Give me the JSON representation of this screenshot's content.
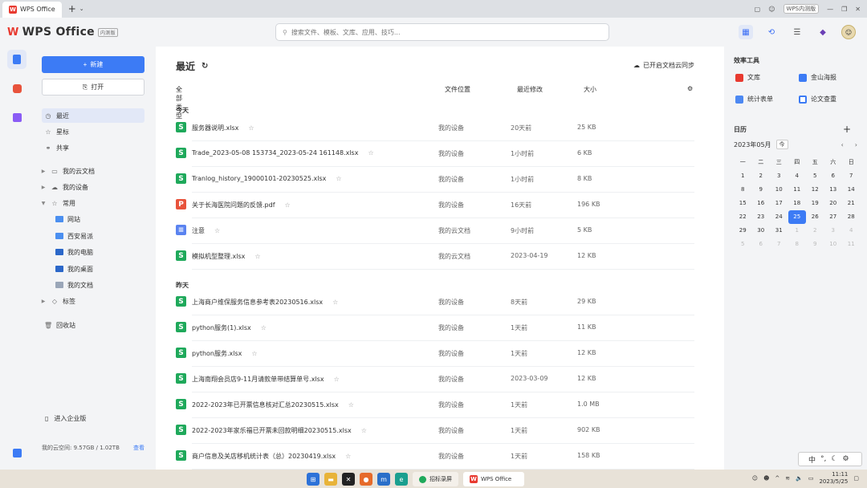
{
  "tab": {
    "label": "WPS Office"
  },
  "titlebar": {
    "badge": "WPS内测版"
  },
  "brand": {
    "name": "WPS Office",
    "tag": "内测版"
  },
  "search": {
    "placeholder": "搜索文件、模板、文库、应用、技巧..."
  },
  "sidebar": {
    "new_label": "新建",
    "open_label": "打开",
    "recent": "最近",
    "starred": "星标",
    "shared": "共享",
    "cloud": "我的云文档",
    "device": "我的设备",
    "common": "常用",
    "f1": "网站",
    "f2": "西安易派",
    "f3": "我的电脑",
    "f4": "我的桌面",
    "f5": "我的文档",
    "tags": "标签",
    "trash": "回收站",
    "enterprise": "进入企业版",
    "storage": "我的云空间: 9.57GB / 1.02TB",
    "storage_link": "查看"
  },
  "main": {
    "title": "最近",
    "sync": "已开启文档云同步",
    "col_type": "全部类型",
    "col_loc": "文件位置",
    "col_mod": "最近修改",
    "col_size": "大小",
    "today": "今天",
    "yesterday": "昨天",
    "files": [
      {
        "name": "服务器说明.xlsx",
        "loc": "我的设备",
        "mod": "20天前",
        "size": "25 KB",
        "kind": "s"
      },
      {
        "name": "Trade_2023-05-08 153734_2023-05-24 161148.xlsx",
        "loc": "我的设备",
        "mod": "1小时前",
        "size": "6 KB",
        "kind": "s"
      },
      {
        "name": "Tranlog_history_19000101-20230525.xlsx",
        "loc": "我的设备",
        "mod": "1小时前",
        "size": "8 KB",
        "kind": "s"
      },
      {
        "name": "关于长海医院问题的反馈.pdf",
        "loc": "我的设备",
        "mod": "16天前",
        "size": "196 KB",
        "kind": "p"
      },
      {
        "name": "注意",
        "loc": "我的云文档",
        "mod": "9小时前",
        "size": "5 KB",
        "kind": "n"
      },
      {
        "name": "模拟机型整理.xlsx",
        "loc": "我的云文档",
        "mod": "2023-04-19",
        "size": "12 KB",
        "kind": "s"
      },
      {
        "name": "上海商户维保服务信息参考表20230516.xlsx",
        "loc": "我的设备",
        "mod": "8天前",
        "size": "29 KB",
        "kind": "s"
      },
      {
        "name": "python服务(1).xlsx",
        "loc": "我的设备",
        "mod": "1天前",
        "size": "11 KB",
        "kind": "s"
      },
      {
        "name": "python服务.xlsx",
        "loc": "我的设备",
        "mod": "1天前",
        "size": "12 KB",
        "kind": "s"
      },
      {
        "name": "上海南翔会员店9-11月请款单带结算单号.xlsx",
        "loc": "我的设备",
        "mod": "2023-03-09",
        "size": "12 KB",
        "kind": "s"
      },
      {
        "name": "2022-2023年已开票信息核对汇总20230515.xlsx",
        "loc": "我的设备",
        "mod": "1天前",
        "size": "1.0 MB",
        "kind": "s"
      },
      {
        "name": "2022-2023年家乐福已开票未回款明细20230515.xlsx",
        "loc": "我的设备",
        "mod": "1天前",
        "size": "902 KB",
        "kind": "s"
      },
      {
        "name": "商户信息及关店移机统计表（总）20230419.xlsx",
        "loc": "我的设备",
        "mod": "1天前",
        "size": "158 KB",
        "kind": "s"
      }
    ]
  },
  "tools": {
    "title": "效率工具",
    "t1": "文库",
    "t2": "金山海报",
    "t3": "统计表单",
    "t4": "论文查重"
  },
  "calendar": {
    "title": "日历",
    "month": "2023年05月",
    "today_btn": "今",
    "weekdays": [
      "一",
      "二",
      "三",
      "四",
      "五",
      "六",
      "日"
    ],
    "days": [
      "1",
      "2",
      "3",
      "4",
      "5",
      "6",
      "7",
      "8",
      "9",
      "10",
      "11",
      "12",
      "13",
      "14",
      "15",
      "16",
      "17",
      "18",
      "19",
      "20",
      "21",
      "22",
      "23",
      "24",
      "25",
      "26",
      "27",
      "28",
      "29",
      "30",
      "31",
      "1",
      "2",
      "3",
      "4",
      "5",
      "6",
      "7",
      "8",
      "9",
      "10",
      "11"
    ],
    "today_index": 24,
    "current_month_count": 31
  },
  "taskbar": {
    "app1": "招标录屏",
    "app2": "WPS Office",
    "time": "11:11",
    "date": "2023/5/25",
    "ime": "中"
  }
}
